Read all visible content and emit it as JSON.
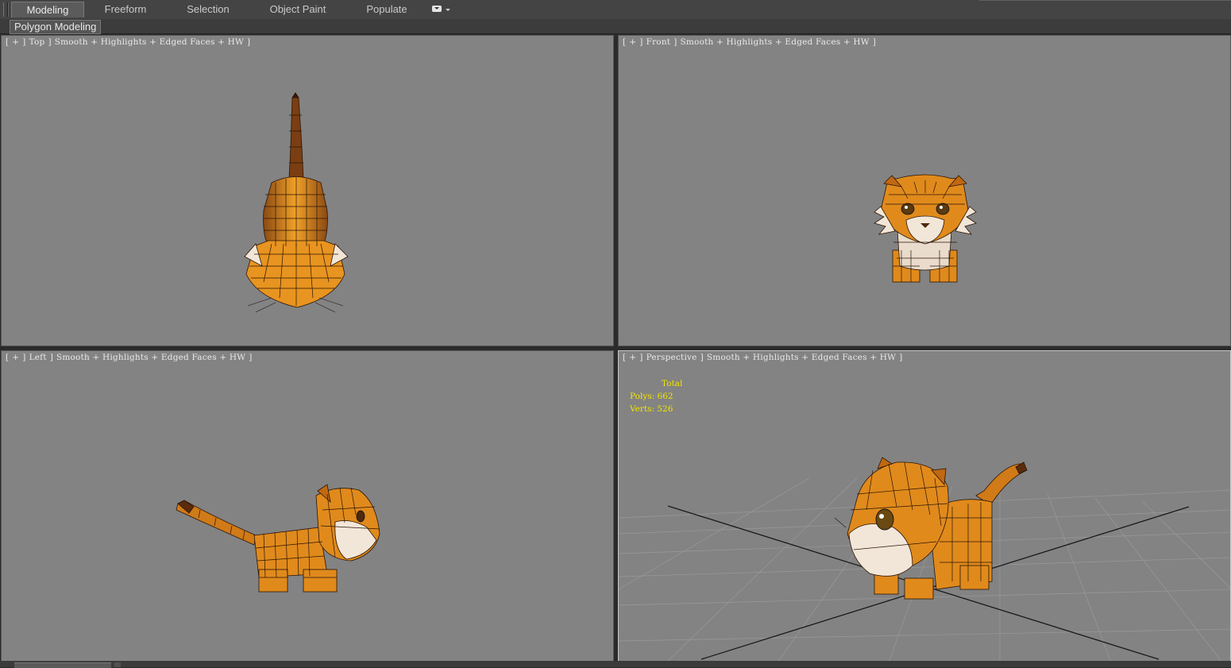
{
  "ribbon": {
    "tabs": [
      {
        "label": "Modeling",
        "active": true
      },
      {
        "label": "Freeform",
        "active": false
      },
      {
        "label": "Selection",
        "active": false
      },
      {
        "label": "Object Paint",
        "active": false
      },
      {
        "label": "Populate",
        "active": false
      }
    ]
  },
  "panel": {
    "label": "Polygon Modeling"
  },
  "viewports": {
    "top": {
      "label_parts": [
        "[",
        "+",
        "]",
        "Top",
        "]",
        "Smooth + Highlights + Edged Faces + HW",
        "]"
      ]
    },
    "front": {
      "label_parts": [
        "[",
        "+",
        "]",
        "Front",
        "]",
        "Smooth + Highlights + Edged Faces + HW",
        "]"
      ]
    },
    "left": {
      "label_parts": [
        "[",
        "+",
        "]",
        "Left",
        "]",
        "Smooth + Highlights + Edged Faces + HW",
        "]"
      ]
    },
    "perspective": {
      "label_parts": [
        "[",
        "+",
        "]",
        "Perspective",
        "]",
        "Smooth + Highlights + Edged Faces + HW",
        "]"
      ]
    }
  },
  "stats": {
    "total": "Total",
    "polys": "Polys: 662",
    "verts": "Verts: 526"
  },
  "colors": {
    "viewport_bg": "#838383",
    "stats_text": "#f2e400",
    "tiger_orange": "#e08a1c",
    "tiger_stripe": "#5a2c0c",
    "tiger_white": "#eadccc"
  }
}
